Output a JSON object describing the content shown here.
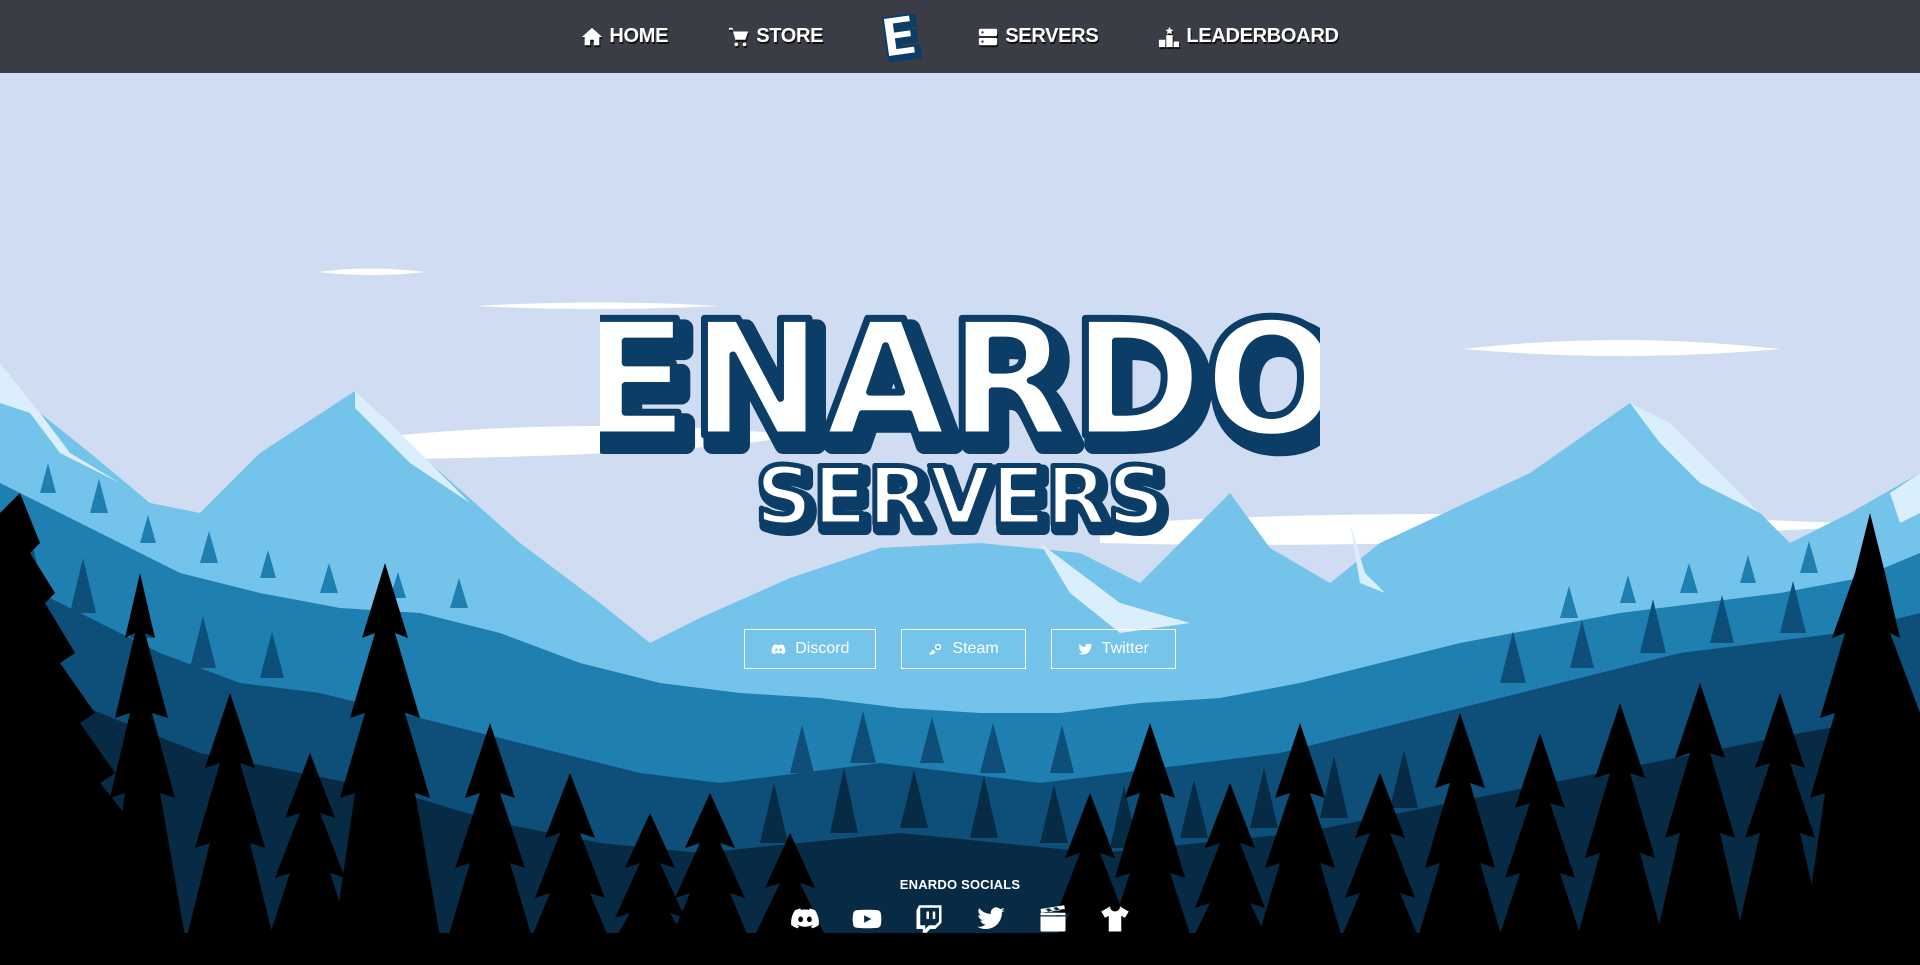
{
  "nav": {
    "items_left": [
      {
        "label": "HOME",
        "icon": "home-icon"
      },
      {
        "label": "STORE",
        "icon": "cart-icon"
      }
    ],
    "logo_letter": "E",
    "items_right": [
      {
        "label": "SERVERS",
        "icon": "server-icon"
      },
      {
        "label": "LEADERBOARD",
        "icon": "podium-icon"
      }
    ]
  },
  "hero": {
    "title": "ENARDO",
    "subtitle": "SERVERS",
    "buttons": [
      {
        "label": "Discord",
        "icon": "discord-icon"
      },
      {
        "label": "Steam",
        "icon": "steam-icon"
      },
      {
        "label": "Twitter",
        "icon": "twitter-icon"
      }
    ]
  },
  "socials": {
    "title": "ENARDO SOCIALS",
    "icons": [
      "discord-icon",
      "youtube-icon",
      "twitch-icon",
      "twitter-icon",
      "clapperboard-icon",
      "tshirt-icon"
    ]
  },
  "colors": {
    "nav_bg": "#3b3d46",
    "sky": "#cfdcf2",
    "mountain_light": "#73c3ea",
    "forest_mid": "#1e7fb0",
    "forest_dark": "#0d4f78",
    "forest_darker": "#072a45",
    "title_outline": "#0b3d66"
  }
}
